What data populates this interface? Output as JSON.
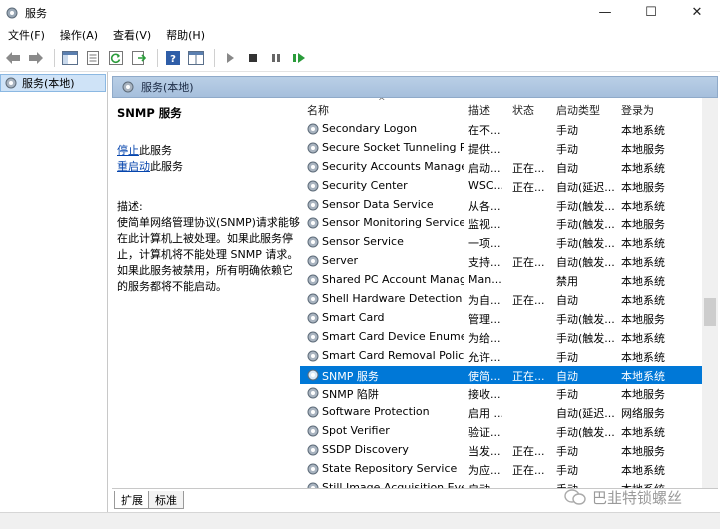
{
  "window": {
    "title": "服务"
  },
  "menu": [
    "文件(F)",
    "操作(A)",
    "查看(V)",
    "帮助(H)"
  ],
  "tree": {
    "root_label": "服务(本地)"
  },
  "pane": {
    "header": "服务(本地)"
  },
  "detail": {
    "title": "SNMP 服务",
    "stop_link": "停止",
    "stop_suffix": "此服务",
    "restart_link": "重启动",
    "restart_suffix": "此服务",
    "desc_label": "描述:",
    "desc_text": "使简单网络管理协议(SNMP)请求能够在此计算机上被处理。如果此服务停止，计算机将不能处理 SNMP 请求。如果此服务被禁用，所有明确依赖它的服务都将不能启动。"
  },
  "columns": {
    "name": "名称",
    "desc": "描述",
    "status": "状态",
    "startup": "启动类型",
    "logon": "登录为"
  },
  "services": [
    {
      "name": "Secondary Logon",
      "desc": "在不...",
      "status": "",
      "startup": "手动",
      "logon": "本地系统"
    },
    {
      "name": "Secure Socket Tunneling P...",
      "desc": "提供...",
      "status": "",
      "startup": "手动",
      "logon": "本地服务"
    },
    {
      "name": "Security Accounts Manager",
      "desc": "启动...",
      "status": "正在...",
      "startup": "自动",
      "logon": "本地系统"
    },
    {
      "name": "Security Center",
      "desc": "WSC...",
      "status": "正在...",
      "startup": "自动(延迟...",
      "logon": "本地服务"
    },
    {
      "name": "Sensor Data Service",
      "desc": "从各...",
      "status": "",
      "startup": "手动(触发...",
      "logon": "本地系统"
    },
    {
      "name": "Sensor Monitoring Service",
      "desc": "监视...",
      "status": "",
      "startup": "手动(触发...",
      "logon": "本地服务"
    },
    {
      "name": "Sensor Service",
      "desc": "一项...",
      "status": "",
      "startup": "手动(触发...",
      "logon": "本地系统"
    },
    {
      "name": "Server",
      "desc": "支持...",
      "status": "正在...",
      "startup": "自动(触发...",
      "logon": "本地系统"
    },
    {
      "name": "Shared PC Account Manager",
      "desc": "Man...",
      "status": "",
      "startup": "禁用",
      "logon": "本地系统"
    },
    {
      "name": "Shell Hardware Detection",
      "desc": "为自...",
      "status": "正在...",
      "startup": "自动",
      "logon": "本地系统"
    },
    {
      "name": "Smart Card",
      "desc": "管理...",
      "status": "",
      "startup": "手动(触发...",
      "logon": "本地服务"
    },
    {
      "name": "Smart Card Device Enumer...",
      "desc": "为给...",
      "status": "",
      "startup": "手动(触发...",
      "logon": "本地系统"
    },
    {
      "name": "Smart Card Removal Policy",
      "desc": "允许...",
      "status": "",
      "startup": "手动",
      "logon": "本地系统"
    },
    {
      "name": "SNMP 服务",
      "desc": "使简...",
      "status": "正在...",
      "startup": "自动",
      "logon": "本地系统",
      "selected": true
    },
    {
      "name": "SNMP 陷阱",
      "desc": "接收...",
      "status": "",
      "startup": "手动",
      "logon": "本地服务"
    },
    {
      "name": "Software Protection",
      "desc": "启用 ...",
      "status": "",
      "startup": "自动(延迟...",
      "logon": "网络服务"
    },
    {
      "name": "Spot Verifier",
      "desc": "验证...",
      "status": "",
      "startup": "手动(触发...",
      "logon": "本地系统"
    },
    {
      "name": "SSDP Discovery",
      "desc": "当发...",
      "status": "正在...",
      "startup": "手动",
      "logon": "本地服务"
    },
    {
      "name": "State Repository Service",
      "desc": "为应...",
      "status": "正在...",
      "startup": "手动",
      "logon": "本地系统"
    },
    {
      "name": "Still Image Acquisition Eve...",
      "desc": "启动...",
      "status": "",
      "startup": "手动",
      "logon": "本地系统"
    }
  ],
  "tabs": [
    "扩展",
    "标准"
  ],
  "watermark": "巴韭特锁螺丝",
  "colors": {
    "selection": "#0078d7",
    "header": "#a9c3e0",
    "link": "#0645ad"
  },
  "icons": [
    "services-app-icon",
    "minimize-icon",
    "maximize-icon",
    "close-icon",
    "back-arrow-icon",
    "forward-arrow-icon",
    "console-tree-icon",
    "properties-icon",
    "refresh-icon",
    "export-list-icon",
    "help-icon",
    "mmc-view-icon",
    "start-service-icon",
    "stop-service-icon",
    "pause-service-icon",
    "restart-service-icon",
    "gear-icon"
  ]
}
